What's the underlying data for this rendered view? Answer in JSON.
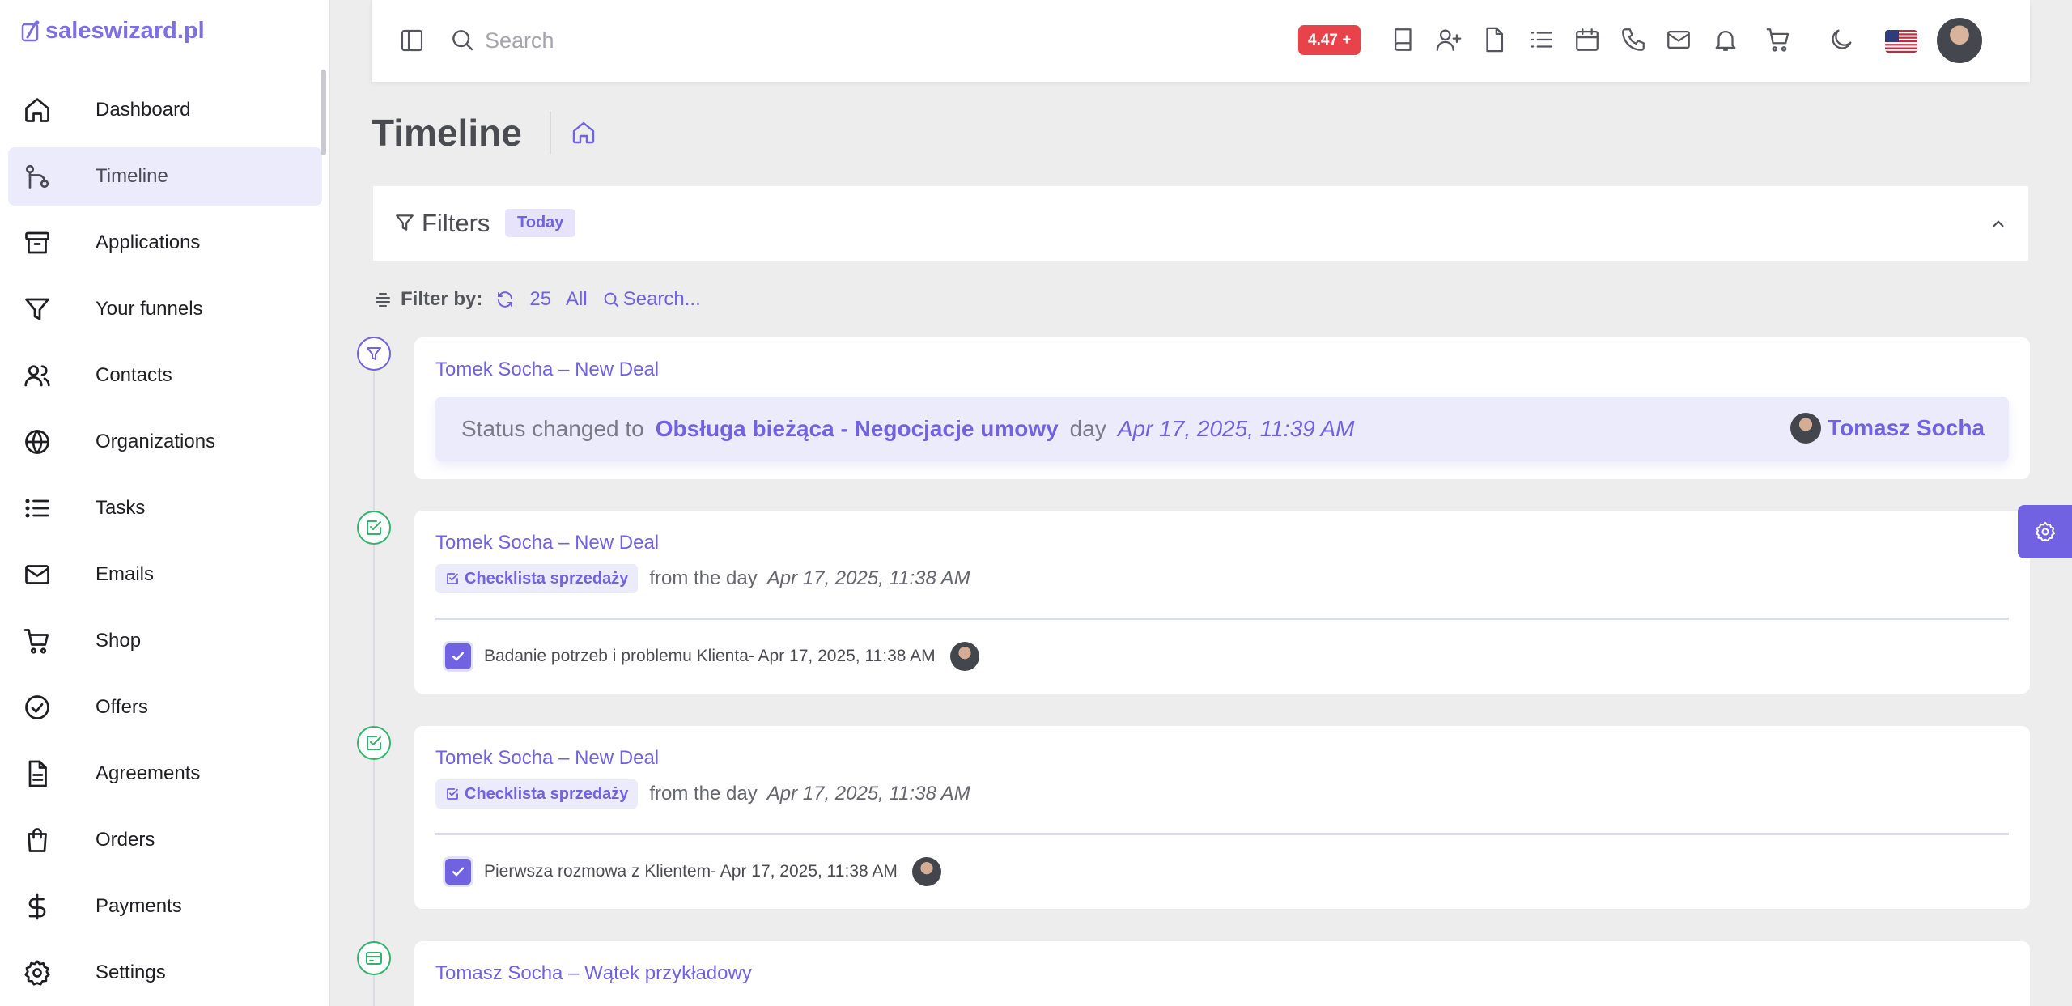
{
  "brand": {
    "name": "saleswizard.pl"
  },
  "sidebar": {
    "items": [
      {
        "label": "Dashboard",
        "icon": "home-icon"
      },
      {
        "label": "Timeline",
        "icon": "git-branch-icon",
        "active": true
      },
      {
        "label": "Applications",
        "icon": "archive-icon"
      },
      {
        "label": "Your funnels",
        "icon": "funnel-icon"
      },
      {
        "label": "Contacts",
        "icon": "users-icon"
      },
      {
        "label": "Organizations",
        "icon": "globe-icon"
      },
      {
        "label": "Tasks",
        "icon": "list-icon"
      },
      {
        "label": "Emails",
        "icon": "mail-icon"
      },
      {
        "label": "Shop",
        "icon": "cart-icon"
      },
      {
        "label": "Offers",
        "icon": "check-circle-icon"
      },
      {
        "label": "Agreements",
        "icon": "file-text-icon"
      },
      {
        "label": "Orders",
        "icon": "shopping-bag-icon"
      },
      {
        "label": "Payments",
        "icon": "dollar-icon"
      },
      {
        "label": "Settings",
        "icon": "gear-icon"
      }
    ]
  },
  "topbar": {
    "search_placeholder": "Search",
    "version_badge": "4.47 +",
    "icons": [
      "book-icon",
      "add-user-icon",
      "file-icon",
      "list-icon",
      "calendar-icon",
      "phone-icon",
      "mail-icon",
      "bell-icon",
      "cart-icon",
      "moon-icon"
    ],
    "language": "us-flag-icon"
  },
  "page": {
    "title": "Timeline"
  },
  "filters": {
    "title": "Filters",
    "badge": "Today"
  },
  "filterbar": {
    "label": "Filter by:",
    "count": "25",
    "scope": "All",
    "search": "Search..."
  },
  "timeline": [
    {
      "type": "status",
      "node_icon": "funnel-icon",
      "node_color": "#7062e0",
      "title": "Tomek Socha – New Deal",
      "prefix": "Status changed to",
      "status": "Obsługa bieżąca - Negocjacje umowy",
      "day_word": "day",
      "date": "Apr 17, 2025, 11:39 AM",
      "user": "Tomasz Socha"
    },
    {
      "type": "checklist",
      "node_icon": "check-square-icon",
      "node_color": "#35b36e",
      "title": "Tomek Socha – New Deal",
      "tag": "Checklista sprzedaży",
      "from_text": "from the day",
      "date": "Apr 17, 2025, 11:38 AM",
      "item": "Badanie potrzeb i problemu Klienta- Apr 17, 2025, 11:38 AM"
    },
    {
      "type": "checklist",
      "node_icon": "check-square-icon",
      "node_color": "#35b36e",
      "title": "Tomek Socha – New Deal",
      "tag": "Checklista sprzedaży",
      "from_text": "from the day",
      "date": "Apr 17, 2025, 11:38 AM",
      "item": "Pierwsza rozmowa z Klientem- Apr 17, 2025, 11:38 AM"
    },
    {
      "type": "thread",
      "node_icon": "card-icon",
      "node_color": "#35b36e",
      "title": "Tomasz Socha – Wątek przykładowy"
    }
  ],
  "colors": {
    "accent": "#7062e0",
    "danger": "#e8424b",
    "success": "#35b36e"
  }
}
